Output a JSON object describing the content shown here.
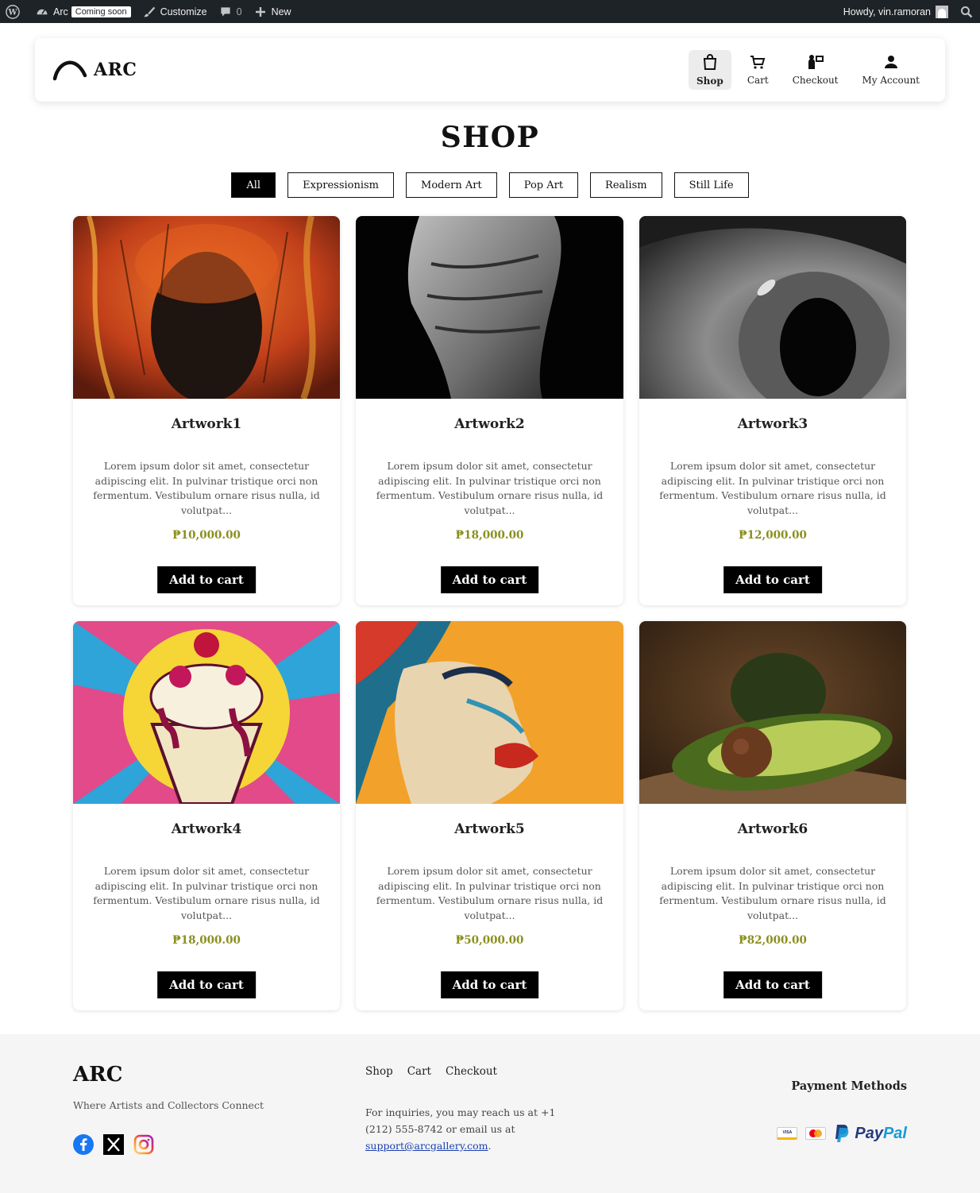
{
  "admin_bar": {
    "site_name": "Arc",
    "coming_soon": "Coming soon",
    "customize": "Customize",
    "comments_count": "0",
    "new_label": "New",
    "howdy": "Howdy, vin.ramoran"
  },
  "header": {
    "logo_text": "ARC",
    "nav": [
      {
        "label": "Shop",
        "icon": "shopping-bag-icon",
        "active": true
      },
      {
        "label": "Cart",
        "icon": "cart-icon"
      },
      {
        "label": "Checkout",
        "icon": "checkout-icon"
      },
      {
        "label": "My Account",
        "icon": "user-icon"
      }
    ]
  },
  "shop": {
    "title": "SHOP",
    "filters": [
      "All",
      "Expressionism",
      "Modern Art",
      "Pop Art",
      "Realism",
      "Still Life"
    ],
    "active_filter": "All",
    "add_to_cart_label": "Add to cart",
    "products": [
      {
        "name": "Artwork1",
        "description": "Lorem ipsum dolor sit amet, consectetur adipiscing elit. In pulvinar tristique orci non fermentum. Vestibulum ornare risus nulla, id volutpat...",
        "price": "₱10,000.00"
      },
      {
        "name": "Artwork2",
        "description": "Lorem ipsum dolor sit amet, consectetur adipiscing elit. In pulvinar tristique orci non fermentum. Vestibulum ornare risus nulla, id volutpat...",
        "price": "₱18,000.00"
      },
      {
        "name": "Artwork3",
        "description": "Lorem ipsum dolor sit amet, consectetur adipiscing elit. In pulvinar tristique orci non fermentum. Vestibulum ornare risus nulla, id volutpat...",
        "price": "₱12,000.00"
      },
      {
        "name": "Artwork4",
        "description": "Lorem ipsum dolor sit amet, consectetur adipiscing elit. In pulvinar tristique orci non fermentum. Vestibulum ornare risus nulla, id volutpat...",
        "price": "₱18,000.00"
      },
      {
        "name": "Artwork5",
        "description": "Lorem ipsum dolor sit amet, consectetur adipiscing elit. In pulvinar tristique orci non fermentum. Vestibulum ornare risus nulla, id volutpat...",
        "price": "₱50,000.00"
      },
      {
        "name": "Artwork6",
        "description": "Lorem ipsum dolor sit amet, consectetur adipiscing elit. In pulvinar tristique orci non fermentum. Vestibulum ornare risus nulla, id volutpat...",
        "price": "₱82,000.00"
      }
    ]
  },
  "footer": {
    "logo_text": "ARC",
    "tagline": "Where Artists and Collectors Connect",
    "links": [
      "Shop",
      "Cart",
      "Checkout"
    ],
    "contact_text": "For inquiries, you may reach us at +1 (212) 555-8742 or email us at",
    "email": "support@arcgallery.com",
    "email_suffix": ".",
    "payment_title": "Payment Methods",
    "visa": "VISA",
    "paypal_a": "Pay",
    "paypal_b": "Pal"
  },
  "colors": {
    "price": "#8b8f1e",
    "admin_bar_bg": "#1d2327",
    "button_bg": "#000000",
    "footer_bg": "#f5f5f5"
  }
}
